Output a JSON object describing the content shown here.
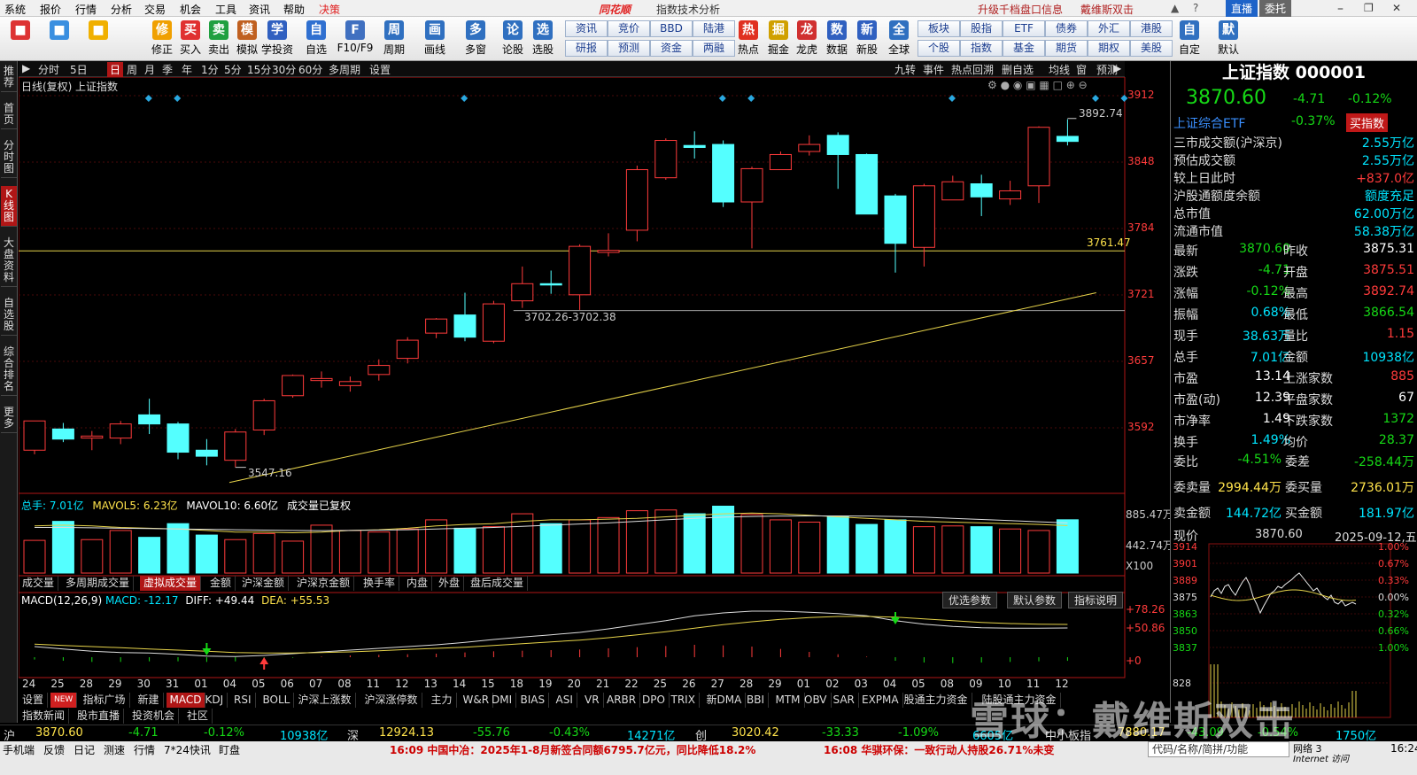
{
  "menu": {
    "items": [
      "系统",
      "报价",
      "行情",
      "分析",
      "交易",
      "机会",
      "工具",
      "资讯",
      "帮助"
    ],
    "highlight": "决策",
    "brand": "同花顺",
    "window_title": "指数技术分析",
    "right_links": [
      "升级千档盘口信息",
      "戴维斯双击"
    ],
    "zhibo": "直播",
    "weituo": "委托"
  },
  "toolbar": {
    "buttons": [
      {
        "label": "",
        "icon": "layout-icon",
        "color": "#d33"
      },
      {
        "label": "",
        "icon": "assistant-icon",
        "color": "#3a8fe0"
      },
      {
        "label": "",
        "icon": "back-arrow-icon",
        "color": "#f0b000"
      },
      {
        "label": "修正",
        "icon": "fix-icon",
        "color": "#f0a000"
      },
      {
        "label": "买入",
        "icon": "buy-icon",
        "color": "#e03030"
      },
      {
        "label": "卖出",
        "icon": "sell-icon",
        "color": "#20a040"
      },
      {
        "label": "模拟",
        "icon": "hammer-icon",
        "color": "#c06020"
      },
      {
        "label": "学投资",
        "icon": "cap-icon",
        "color": "#3060c0"
      },
      {
        "label": "自选",
        "icon": "star-icon",
        "color": "#3070d0"
      },
      {
        "label": "F10/F9",
        "icon": "f10-icon",
        "color": "#4070c0"
      },
      {
        "label": "周期",
        "icon": "clock-icon",
        "color": "#3070c0"
      },
      {
        "label": "画线",
        "icon": "pen-icon",
        "color": "#3070c0"
      },
      {
        "label": "多窗",
        "icon": "window-icon",
        "color": "#3070c0"
      },
      {
        "label": "论股",
        "icon": "forum-icon",
        "color": "#3070c0"
      },
      {
        "label": "选股",
        "icon": "search-icon",
        "color": "#3070c0"
      }
    ],
    "grid1": [
      [
        "资讯",
        "竞价",
        "BBD",
        "陆港"
      ],
      [
        "研报",
        "预测",
        "资金",
        "两融"
      ]
    ],
    "buttons2": [
      {
        "label": "热点",
        "icon": "fire-icon",
        "color": "#e03020"
      },
      {
        "label": "掘金",
        "icon": "gold-icon",
        "color": "#d0a000"
      },
      {
        "label": "龙虎",
        "icon": "dragon-icon",
        "color": "#d03030"
      },
      {
        "label": "数据",
        "icon": "pe-icon",
        "color": "#3060c0"
      },
      {
        "label": "新股",
        "icon": "ipo-icon",
        "color": "#3060c0"
      },
      {
        "label": "全球",
        "icon": "globe-icon",
        "color": "#3070c0"
      }
    ],
    "grid2": [
      [
        "板块",
        "股指",
        "ETF",
        "债券",
        "外汇",
        "港股"
      ],
      [
        "个股",
        "指数",
        "基金",
        "期货",
        "期权",
        "美股"
      ]
    ],
    "buttons3": [
      {
        "label": "自定",
        "icon": "custom-icon",
        "color": "#3070c0"
      },
      {
        "label": "默认",
        "icon": "home-icon",
        "color": "#3070c0"
      }
    ]
  },
  "left_tabs": [
    "推荐",
    "首页",
    "分时图",
    "K线图",
    "大盘资料",
    "自选股",
    "综合排名",
    "更多"
  ],
  "period_bar": {
    "items": [
      "分时",
      "5日",
      "日",
      "周",
      "月",
      "季",
      "年",
      "1分",
      "5分",
      "15分",
      "30分",
      "60分",
      "多周期",
      "设置"
    ],
    "active": "日",
    "right_tools": [
      "九转",
      "事件",
      "热点回溯",
      "删自选",
      "均线",
      "窗",
      "预测"
    ]
  },
  "chart_header": {
    "mode": "日线(复权)",
    "name": "上证指数"
  },
  "y_axis": {
    "ticks": [
      "3912",
      "3848",
      "3784",
      "3721",
      "3657",
      "3592"
    ]
  },
  "annotations": {
    "high": "3892.74",
    "low": "3547.16",
    "range": "3702.26-3702.38",
    "hline": "3761.47"
  },
  "volume_header": {
    "total": "总手: 7.01亿",
    "ma5": "MAVOL5: 6.23亿",
    "ma10": "MAVOL10: 6.60亿",
    "note": "成交量已复权"
  },
  "volume_axis": {
    "ticks": [
      "885.47万",
      "442.74万"
    ],
    "unit": "X100"
  },
  "volume_tabs": [
    "成交量",
    "多周期成交量",
    "虚拟成交量",
    "金额",
    "沪深金额",
    "沪深京金额",
    "换手率",
    "内盘",
    "外盘",
    "盘后成交量"
  ],
  "volume_tab_active": "虚拟成交量",
  "macd_header": {
    "name": "MACD(12,26,9)",
    "macd": "MACD: -12.17",
    "diff": "DIFF: +49.44",
    "dea": "DEA: +55.53"
  },
  "macd_buttons": [
    "优选参数",
    "默认参数",
    "指标说明"
  ],
  "macd_axis": {
    "ticks": [
      "+78.26",
      "+50.86",
      "+0"
    ]
  },
  "x_axis": {
    "labels": [
      "24",
      "25",
      "28",
      "29",
      "30",
      "31",
      "01",
      "04",
      "05",
      "06",
      "07",
      "08",
      "11",
      "12",
      "13",
      "14",
      "15",
      "18",
      "19",
      "20",
      "21",
      "22",
      "25",
      "26",
      "27",
      "28",
      "29",
      "01",
      "02",
      "03",
      "04",
      "05",
      "08",
      "09",
      "10",
      "11",
      "12"
    ]
  },
  "indicator_tabs": [
    "设置",
    "NEW",
    "指标广场",
    "新建",
    "MACD",
    "KDJ",
    "RSI",
    "BOLL",
    "沪深上涨数",
    "沪深涨停数",
    "主力",
    "W&R",
    "DMI",
    "BIAS",
    "ASI",
    "VR",
    "ARBR",
    "DPO",
    "TRIX",
    "新DMA",
    "BBI",
    "MTM",
    "OBV",
    "SAR",
    "EXPMA",
    "股通主力资金",
    "陆股通主力资金"
  ],
  "indicator_active": "MACD",
  "news_tabs": [
    "指数新闻",
    "股市直播",
    "投资机会",
    "社区"
  ],
  "right_panel": {
    "title": "上证指数 000001",
    "price": "3870.60",
    "change": "-4.71",
    "pct": "-0.12%",
    "etf_name": "上证综合ETF",
    "etf_pct": "-0.37%",
    "buy_label": "买指数",
    "info_rows": [
      {
        "label": "三市成交额(沪深京)",
        "value": "2.55万亿",
        "color": "cyan"
      },
      {
        "label": "预估成交额",
        "value": "2.55万亿",
        "color": "cyan"
      },
      {
        "label": "较上日此时",
        "value": "+837.0亿",
        "color": "red"
      },
      {
        "label": "沪股通额度余额",
        "value": "额度充足",
        "color": "cyan"
      },
      {
        "label": "总市值",
        "value": "62.00万亿",
        "color": "cyan"
      },
      {
        "label": "流通市值",
        "value": "58.38万亿",
        "color": "cyan"
      }
    ],
    "quote_rows": [
      [
        {
          "l": "最新",
          "v": "3870.60",
          "c": "green"
        },
        {
          "l": "昨收",
          "v": "3875.31",
          "c": "white"
        }
      ],
      [
        {
          "l": "涨跌",
          "v": "-4.71",
          "c": "green"
        },
        {
          "l": "开盘",
          "v": "3875.51",
          "c": "red"
        }
      ],
      [
        {
          "l": "涨幅",
          "v": "-0.12%",
          "c": "green"
        },
        {
          "l": "最高",
          "v": "3892.74",
          "c": "red"
        }
      ],
      [
        {
          "l": "振幅",
          "v": "0.68%",
          "c": "cyan"
        },
        {
          "l": "最低",
          "v": "3866.54",
          "c": "green"
        }
      ],
      [
        {
          "l": "现手",
          "v": "38.63万",
          "c": "cyan"
        },
        {
          "l": "量比",
          "v": "1.15",
          "c": "red"
        }
      ],
      [
        {
          "l": "总手",
          "v": "7.01亿",
          "c": "cyan"
        },
        {
          "l": "金额",
          "v": "10938亿",
          "c": "cyan"
        }
      ]
    ],
    "quote_rows2": [
      [
        {
          "l": "市盈",
          "v": "13.14",
          "c": "white"
        },
        {
          "l": "上涨家数",
          "v": "885",
          "c": "red"
        }
      ],
      [
        {
          "l": "市盈(动)",
          "v": "12.39",
          "c": "white"
        },
        {
          "l": "平盘家数",
          "v": "67",
          "c": "white"
        }
      ],
      [
        {
          "l": "市净率",
          "v": "1.49",
          "c": "white"
        },
        {
          "l": "下跌家数",
          "v": "1372",
          "c": "green"
        }
      ],
      [
        {
          "l": "换手",
          "v": "1.49%",
          "c": "cyan"
        },
        {
          "l": "均价",
          "v": "28.37",
          "c": "green"
        }
      ]
    ],
    "weibi": {
      "l": "委比",
      "v": "-4.51%",
      "l2": "委差",
      "v2": "-258.44万"
    },
    "weimai": {
      "l": "委卖量",
      "v": "2994.44万",
      "l2": "委买量",
      "v2": "2736.01万"
    },
    "jine": {
      "l": "卖金额",
      "v": "144.72亿",
      "l2": "买金额",
      "v2": "181.97亿"
    },
    "mini": {
      "label": "现价",
      "price": "3870.60",
      "date": "2025-09-12,五",
      "left_ticks": [
        "3914",
        "3901",
        "3889",
        "3875",
        "3863",
        "3850",
        "3837",
        "828"
      ],
      "right_ticks": [
        "1.00%",
        "0.67%",
        "0.33%",
        "0.00%",
        "0.32%",
        "0.66%",
        "1.00%"
      ]
    }
  },
  "quote_bar": {
    "sh": {
      "label": "沪",
      "price": "3870.60",
      "chg": "-4.71",
      "pct": "-0.12%",
      "amt": "10938亿"
    },
    "sz": {
      "label": "深",
      "price": "12924.13",
      "chg": "-55.76",
      "pct": "-0.43%",
      "amt": "14271亿"
    },
    "cy": {
      "label": "创",
      "price": "3020.42",
      "chg": "-33.33",
      "pct": "-1.09%",
      "amt": "6605亿"
    },
    "zxb": {
      "label": "中小板指",
      "price": "7880.17",
      "chg": "-43.09",
      "pct": "-0.54%",
      "amt": "1750亿"
    }
  },
  "status": {
    "items": [
      "手机端",
      "反馈",
      "日记",
      "测速",
      "行情",
      "7*24快讯",
      "盯盘"
    ],
    "news1": "16:09 中国中冶：2025年1-8月新签合同额6795.7亿元，同比降低18.2%",
    "news2": "16:08 华骐环保：一致行动人持股26.71%未变",
    "search": "代码/名称/简拼/功能",
    "net": "网络 3",
    "net2": "Internet 访问",
    "time": "16:24"
  },
  "watermark": "雪球：戴维斯双击",
  "chart_data": {
    "type": "candlestick",
    "title": "上证指数",
    "ylim": [
      3530,
      3925
    ],
    "dates": [
      "24",
      "25",
      "28",
      "29",
      "30",
      "31",
      "01",
      "04",
      "05",
      "06",
      "07",
      "08",
      "11",
      "12",
      "13",
      "14",
      "15",
      "18",
      "19",
      "20",
      "21",
      "22",
      "25",
      "26",
      "27",
      "28",
      "29",
      "01",
      "02",
      "03",
      "04",
      "05",
      "08",
      "09",
      "10",
      "11",
      "12"
    ],
    "candles": [
      [
        3564,
        3593,
        3593,
        3560
      ],
      [
        3585,
        3575,
        3591,
        3572
      ],
      [
        3576,
        3578,
        3583,
        3564
      ],
      [
        3576,
        3590,
        3593,
        3570
      ],
      [
        3599,
        3590,
        3615,
        3580
      ],
      [
        3590,
        3562,
        3592,
        3555
      ],
      [
        3564,
        3558,
        3575,
        3549
      ],
      [
        3554,
        3582,
        3585,
        3547
      ],
      [
        3584,
        3613,
        3615,
        3579
      ],
      [
        3618,
        3638,
        3639,
        3616
      ],
      [
        3633,
        3635,
        3642,
        3626
      ],
      [
        3628,
        3632,
        3637,
        3622
      ],
      [
        3639,
        3648,
        3654,
        3633
      ],
      [
        3655,
        3673,
        3676,
        3650
      ],
      [
        3680,
        3694,
        3695,
        3675
      ],
      [
        3698,
        3676,
        3720,
        3672
      ],
      [
        3672,
        3709,
        3712,
        3670
      ],
      [
        3712,
        3729,
        3746,
        3705
      ],
      [
        3729,
        3728,
        3742,
        3719
      ],
      [
        3718,
        3766,
        3768,
        3703
      ],
      [
        3760,
        3762,
        3779,
        3756
      ],
      [
        3782,
        3842,
        3846,
        3771
      ],
      [
        3834,
        3871,
        3873,
        3832
      ],
      [
        3866,
        3864,
        3880,
        3853
      ],
      [
        3867,
        3810,
        3871,
        3805
      ],
      [
        3810,
        3843,
        3845,
        3764
      ],
      [
        3842,
        3857,
        3860,
        3844
      ],
      [
        3860,
        3867,
        3876,
        3856
      ],
      [
        3876,
        3857,
        3879,
        3823
      ],
      [
        3857,
        3798,
        3858,
        3810
      ],
      [
        3816,
        3769,
        3818,
        3740
      ],
      [
        3765,
        3826,
        3828,
        3746
      ],
      [
        3812,
        3830,
        3836,
        3816
      ],
      [
        3828,
        3815,
        3837,
        3796
      ],
      [
        3813,
        3821,
        3831,
        3807
      ],
      [
        3826,
        3884,
        3885,
        3809
      ],
      [
        3875,
        3870,
        3892,
        3866
      ]
    ],
    "volume_ylim": [
      0,
      885.47
    ],
    "volume": [
      430,
      680,
      440,
      560,
      470,
      650,
      500,
      440,
      520,
      420,
      630,
      560,
      540,
      580,
      700,
      590,
      610,
      780,
      650,
      700,
      730,
      820,
      830,
      780,
      880,
      770,
      700,
      670,
      740,
      640,
      700,
      610,
      620,
      610,
      580,
      560,
      701
    ],
    "volume_ma5": [
      620,
      630,
      620,
      600,
      590,
      580,
      560,
      540,
      540,
      530,
      540,
      560,
      570,
      590,
      620,
      640,
      650,
      680,
      700,
      700,
      710,
      720,
      740,
      760,
      780,
      790,
      780,
      760,
      740,
      720,
      700,
      680,
      670,
      660,
      650,
      640,
      623
    ],
    "volume_ma10": [
      600,
      600,
      595,
      590,
      585,
      580,
      575,
      570,
      565,
      560,
      558,
      560,
      565,
      570,
      580,
      590,
      600,
      615,
      630,
      645,
      660,
      680,
      700,
      720,
      735,
      745,
      750,
      752,
      752,
      750,
      745,
      735,
      720,
      705,
      690,
      675,
      660
    ],
    "macd_ylim": [
      -15,
      90
    ],
    "diff": [
      18,
      14,
      10,
      8,
      7,
      5,
      2,
      1,
      3,
      6,
      9,
      12,
      15,
      18,
      21,
      25,
      30,
      34,
      38,
      42,
      48,
      55,
      62,
      70,
      75,
      78,
      78,
      76,
      74,
      70,
      62,
      56,
      52,
      50,
      49,
      49,
      49.44
    ],
    "dea": [
      22,
      20,
      18,
      16,
      14,
      12,
      10,
      8,
      7,
      7,
      8,
      9,
      11,
      13,
      15,
      17,
      20,
      23,
      26,
      29,
      33,
      38,
      43,
      49,
      55,
      60,
      64,
      67,
      69,
      69,
      68,
      65,
      62,
      59,
      57,
      56,
      55.53
    ],
    "macd": [
      -8,
      -12,
      -16,
      -16,
      -14,
      -14,
      -16,
      -14,
      -8,
      -2,
      2,
      6,
      8,
      10,
      12,
      16,
      20,
      22,
      24,
      26,
      30,
      34,
      38,
      42,
      40,
      36,
      28,
      18,
      10,
      2,
      -12,
      -18,
      -20,
      -18,
      -16,
      -14,
      -12.17
    ],
    "hline": 3761.47,
    "trendline": [
      [
        0,
        3532
      ],
      [
        37,
        3720
      ]
    ]
  }
}
